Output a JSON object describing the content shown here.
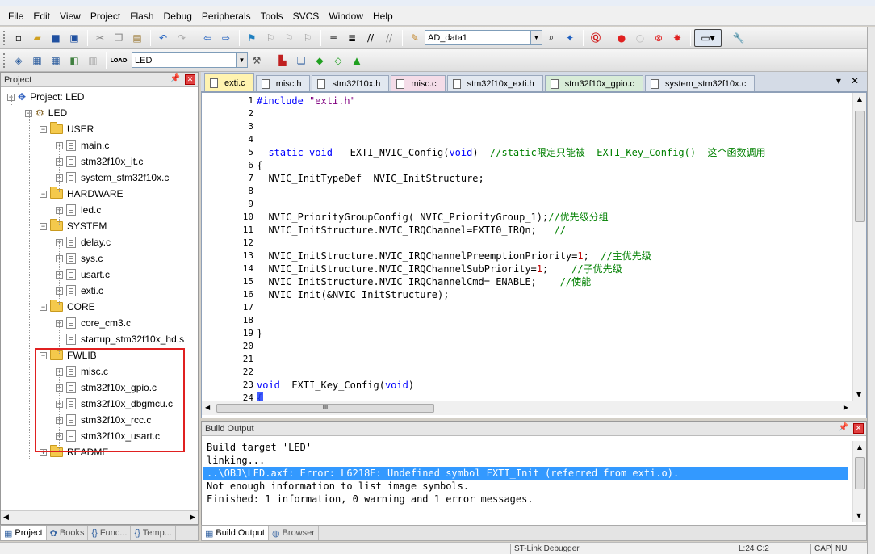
{
  "menu": [
    "File",
    "Edit",
    "View",
    "Project",
    "Flash",
    "Debug",
    "Peripherals",
    "Tools",
    "SVCS",
    "Window",
    "Help"
  ],
  "toolbar": {
    "config_combo": "AD_data1",
    "target_combo": "LED"
  },
  "project_panel": {
    "title": "Project",
    "tree": [
      {
        "label": "Project: LED",
        "level": 0,
        "type": "root",
        "expander": "-"
      },
      {
        "label": "LED",
        "level": 1,
        "type": "target",
        "expander": "-"
      },
      {
        "label": "USER",
        "level": 2,
        "type": "folder",
        "expander": "-"
      },
      {
        "label": "main.c",
        "level": 3,
        "type": "file",
        "expander": "+"
      },
      {
        "label": "stm32f10x_it.c",
        "level": 3,
        "type": "file",
        "expander": "+"
      },
      {
        "label": "system_stm32f10x.c",
        "level": 3,
        "type": "file",
        "expander": "+"
      },
      {
        "label": "HARDWARE",
        "level": 2,
        "type": "folder",
        "expander": "-"
      },
      {
        "label": "led.c",
        "level": 3,
        "type": "file",
        "expander": "+"
      },
      {
        "label": "SYSTEM",
        "level": 2,
        "type": "folder",
        "expander": "-"
      },
      {
        "label": "delay.c",
        "level": 3,
        "type": "file",
        "expander": "+"
      },
      {
        "label": "sys.c",
        "level": 3,
        "type": "file",
        "expander": "+"
      },
      {
        "label": "usart.c",
        "level": 3,
        "type": "file",
        "expander": "+"
      },
      {
        "label": "exti.c",
        "level": 3,
        "type": "file",
        "expander": "+"
      },
      {
        "label": "CORE",
        "level": 2,
        "type": "folder",
        "expander": "-"
      },
      {
        "label": "core_cm3.c",
        "level": 3,
        "type": "file",
        "expander": "+"
      },
      {
        "label": "startup_stm32f10x_hd.s",
        "level": 3,
        "type": "file",
        "expander": ""
      },
      {
        "label": "FWLIB",
        "level": 2,
        "type": "folder",
        "expander": "-"
      },
      {
        "label": "misc.c",
        "level": 3,
        "type": "file",
        "expander": "+"
      },
      {
        "label": "stm32f10x_gpio.c",
        "level": 3,
        "type": "file",
        "expander": "+"
      },
      {
        "label": "stm32f10x_dbgmcu.c",
        "level": 3,
        "type": "file",
        "expander": "+"
      },
      {
        "label": "stm32f10x_rcc.c",
        "level": 3,
        "type": "file",
        "expander": "+"
      },
      {
        "label": "stm32f10x_usart.c",
        "level": 3,
        "type": "file",
        "expander": "+"
      },
      {
        "label": "README",
        "level": 2,
        "type": "folder",
        "expander": "+"
      }
    ],
    "tabs": [
      {
        "label": "Project",
        "icon": "project-icon",
        "active": true
      },
      {
        "label": "Books",
        "icon": "books-icon",
        "active": false
      },
      {
        "label": "Func...",
        "icon": "braces",
        "active": false
      },
      {
        "label": "Temp...",
        "icon": "template-icon",
        "active": false
      }
    ]
  },
  "editor": {
    "tabs": [
      {
        "label": "exti.c",
        "style": "active"
      },
      {
        "label": "misc.h",
        "style": "hdr"
      },
      {
        "label": "stm32f10x.h",
        "style": "hdr"
      },
      {
        "label": "misc.c",
        "style": "pink"
      },
      {
        "label": "stm32f10x_exti.h",
        "style": "hdr"
      },
      {
        "label": "stm32f10x_gpio.c",
        "style": "green"
      },
      {
        "label": "system_stm32f10x.c",
        "style": "hdr"
      }
    ],
    "lines": [
      {
        "n": "1",
        "html": "<span class=\"kw\">#include</span> <span class=\"str\">\"exti.h\"</span>"
      },
      {
        "n": "2",
        "html": ""
      },
      {
        "n": "3",
        "html": ""
      },
      {
        "n": "4",
        "html": ""
      },
      {
        "n": "5",
        "html": "  <span class=\"kw\">static void</span>   EXTI_NVIC_Config(<span class=\"kw\">void</span>)  <span class=\"cm\">//static限定只能被  EXTI_Key_Config()  这个函数调用</span>"
      },
      {
        "n": "6",
        "html": "{"
      },
      {
        "n": "7",
        "html": "  NVIC_InitTypeDef  NVIC_InitStructure;"
      },
      {
        "n": "8",
        "html": ""
      },
      {
        "n": "9",
        "html": ""
      },
      {
        "n": "10",
        "html": "  NVIC_PriorityGroupConfig( NVIC_PriorityGroup_1);<span class=\"cm\">//优先级分组</span>"
      },
      {
        "n": "11",
        "html": "  NVIC_InitStructure.NVIC_IRQChannel=EXTI0_IRQn;   <span class=\"cm\">//</span>"
      },
      {
        "n": "12",
        "html": ""
      },
      {
        "n": "13",
        "html": "  NVIC_InitStructure.NVIC_IRQChannelPreemptionPriority=<span class=\"num\">1</span>;  <span class=\"cm\">//主优先级</span>"
      },
      {
        "n": "14",
        "html": "  NVIC_InitStructure.NVIC_IRQChannelSubPriority=<span class=\"num\">1</span>;    <span class=\"cm\">//子优先级</span>"
      },
      {
        "n": "15",
        "html": "  NVIC_InitStructure.NVIC_IRQChannelCmd= ENABLE;    <span class=\"cm\">//使能</span>"
      },
      {
        "n": "16",
        "html": "  NVIC_Init(&amp;NVIC_InitStructure);"
      },
      {
        "n": "17",
        "html": ""
      },
      {
        "n": "18",
        "html": ""
      },
      {
        "n": "19",
        "html": "}"
      },
      {
        "n": "20",
        "html": ""
      },
      {
        "n": "21",
        "html": ""
      },
      {
        "n": "22",
        "html": ""
      },
      {
        "n": "23",
        "html": "<span class=\"kw\">void</span>  EXTI_Key_Config(<span class=\"kw\">void</span>)"
      },
      {
        "n": "24",
        "html": "{"
      }
    ],
    "hscroll_thumb": "III"
  },
  "build_output": {
    "title": "Build Output",
    "lines": [
      {
        "text": "Build target 'LED'",
        "selected": false
      },
      {
        "text": "linking...",
        "selected": false
      },
      {
        "text": "..\\OBJ\\LED.axf: Error: L6218E: Undefined symbol EXTI_Init (referred from exti.o).",
        "selected": true
      },
      {
        "text": "Not enough information to list image symbols.",
        "selected": false
      },
      {
        "text": "Finished: 1 information, 0 warning and 1 error messages.",
        "selected": false
      }
    ],
    "tabs": [
      {
        "label": "Build Output",
        "icon": "build-icon",
        "active": true
      },
      {
        "label": "Browser",
        "icon": "browser-icon",
        "active": false
      }
    ]
  },
  "statusbar": {
    "debugger": "ST-Link Debugger",
    "position": "L:24 C:2",
    "cap": "CAP",
    "num": "NU"
  }
}
